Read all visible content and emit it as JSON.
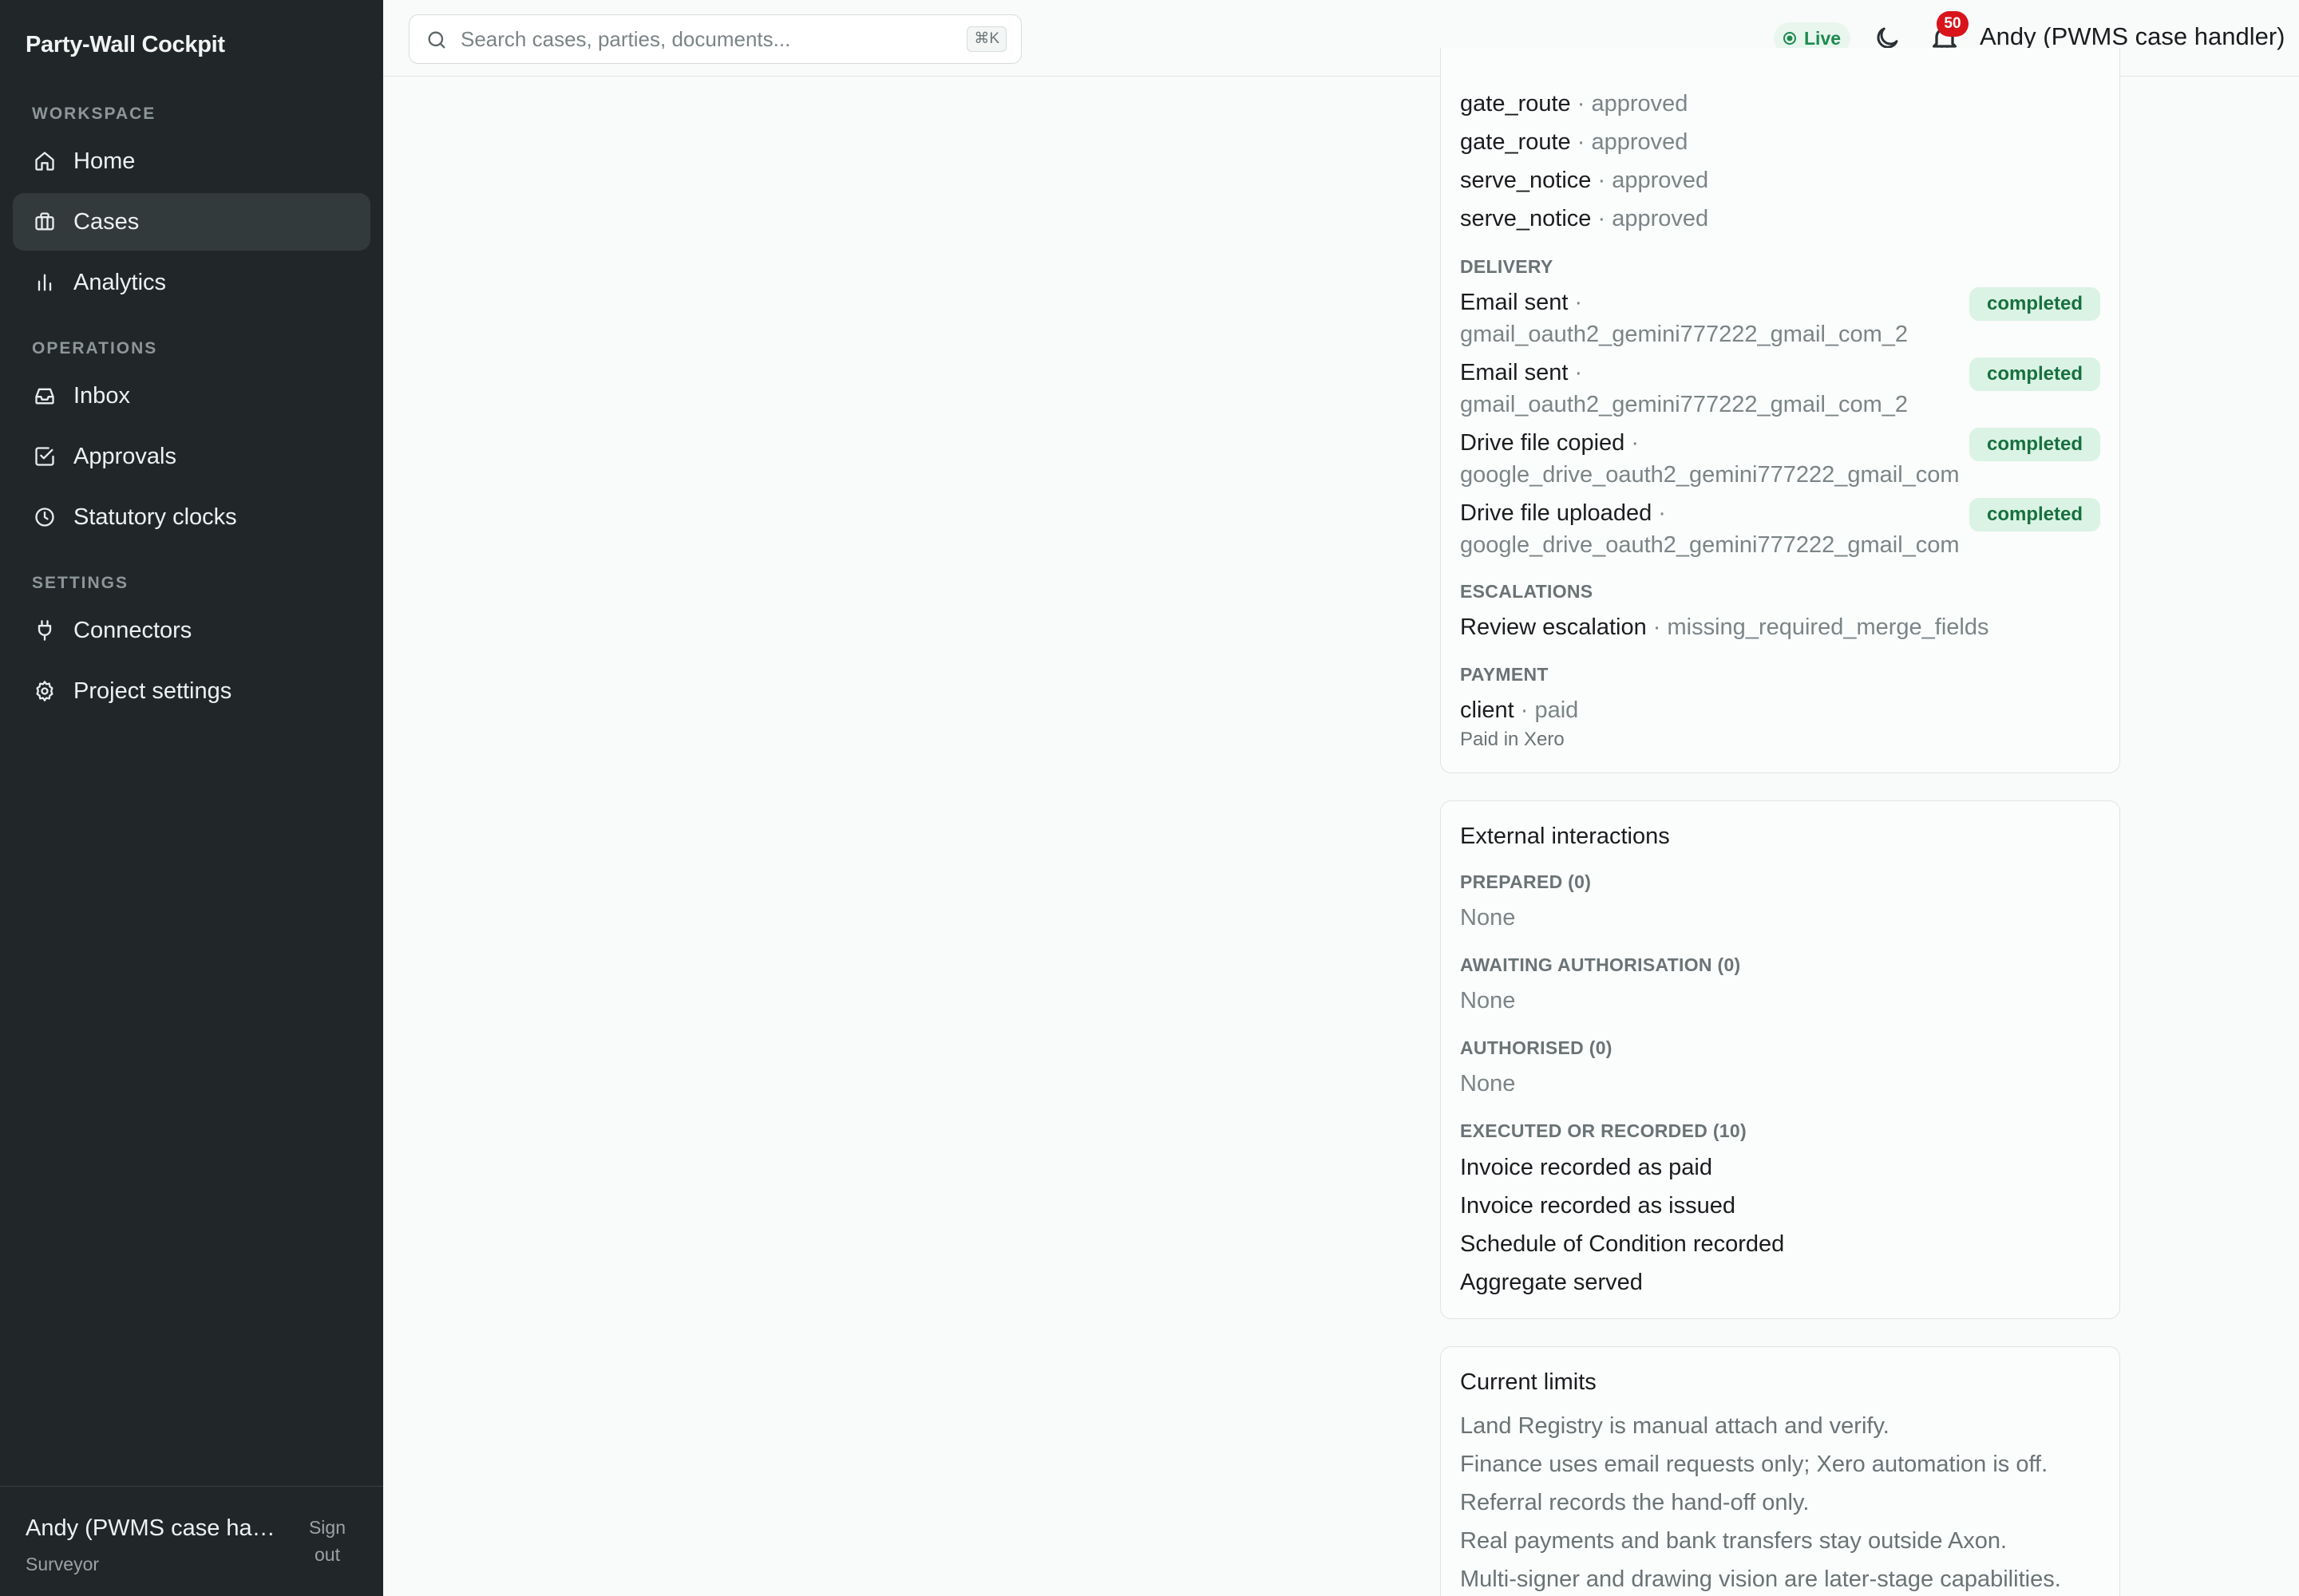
{
  "app": {
    "brand": "Party-Wall Cockpit"
  },
  "sidebar": {
    "sections": [
      {
        "label": "WORKSPACE"
      },
      {
        "label": "OPERATIONS"
      },
      {
        "label": "SETTINGS"
      }
    ],
    "items": [
      {
        "label": "Home",
        "icon": "home-icon"
      },
      {
        "label": "Cases",
        "icon": "briefcase-icon",
        "active": true
      },
      {
        "label": "Analytics",
        "icon": "bar-chart-icon"
      },
      {
        "label": "Inbox",
        "icon": "inbox-icon"
      },
      {
        "label": "Approvals",
        "icon": "check-square-icon"
      },
      {
        "label": "Statutory clocks",
        "icon": "clock-icon"
      },
      {
        "label": "Connectors",
        "icon": "plug-icon"
      },
      {
        "label": "Project settings",
        "icon": "gear-icon"
      }
    ],
    "footer": {
      "user_name": "Andy (PWMS case handler)",
      "user_role": "Surveyor",
      "signout_label": "Sign out"
    }
  },
  "topbar": {
    "search_placeholder": "Search cases, parties, documents...",
    "shortcut": "⌘K",
    "live_label": "Live",
    "notification_count": "50",
    "user_name": "Andy (PWMS case handler)"
  },
  "timeline_card": {
    "approvals": [
      {
        "name": "gate_route",
        "status": "approved"
      },
      {
        "name": "gate_route",
        "status": "approved"
      },
      {
        "name": "serve_notice",
        "status": "approved"
      },
      {
        "name": "serve_notice",
        "status": "approved"
      }
    ],
    "delivery_label": "DELIVERY",
    "delivery": [
      {
        "title": "Email sent",
        "account": "gmail_oauth2_gemini777222_gmail_com_2",
        "status": "completed"
      },
      {
        "title": "Email sent",
        "account": "gmail_oauth2_gemini777222_gmail_com_2",
        "status": "completed"
      },
      {
        "title": "Drive file copied",
        "account": "google_drive_oauth2_gemini777222_gmail_com",
        "status": "completed"
      },
      {
        "title": "Drive file uploaded",
        "account": "google_drive_oauth2_gemini777222_gmail_com",
        "status": "completed"
      }
    ],
    "escalations_label": "ESCALATIONS",
    "escalation": {
      "title": "Review escalation",
      "reason": "missing_required_merge_fields"
    },
    "payment_label": "PAYMENT",
    "payment": {
      "party": "client",
      "status": "paid",
      "note": "Paid in Xero"
    }
  },
  "external_card": {
    "title": "External interactions",
    "prepared_label": "PREPARED (0)",
    "prepared_value": "None",
    "awaiting_label": "AWAITING AUTHORISATION (0)",
    "awaiting_value": "None",
    "authorised_label": "AUTHORISED (0)",
    "authorised_value": "None",
    "executed_label": "EXECUTED OR RECORDED (10)",
    "executed": [
      "Invoice recorded as paid",
      "Invoice recorded as issued",
      "Schedule of Condition recorded",
      "Aggregate served"
    ]
  },
  "limits_card": {
    "title": "Current limits",
    "items": [
      "Land Registry is manual attach and verify.",
      "Finance uses email requests only; Xero automation is off.",
      "Referral records the hand-off only.",
      "Real payments and bank transfers stay outside Axon.",
      "Multi-signer and drawing vision are later-stage capabilities."
    ]
  }
}
